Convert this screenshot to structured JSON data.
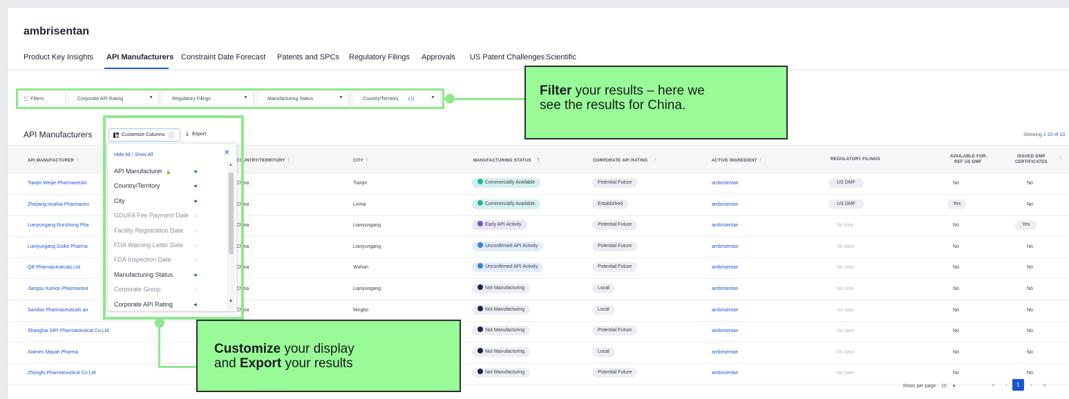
{
  "page": {
    "title": "ambrisentan",
    "tabs": [
      {
        "label": "Product Key Insights",
        "active": false
      },
      {
        "label": "API Manufacturers",
        "active": true
      },
      {
        "label": "Constraint Date Forecast",
        "active": false
      },
      {
        "label": "Patents and SPCs",
        "active": false
      },
      {
        "label": "Regulatory Filings",
        "active": false
      },
      {
        "label": "Approvals",
        "active": false
      },
      {
        "label": "US Patent Challenges",
        "active": false
      },
      {
        "label": "Scientific",
        "active": false
      }
    ]
  },
  "filters": {
    "label": "Filters",
    "items": [
      {
        "label": "Corporate API Rating",
        "count": ""
      },
      {
        "label": "Regulatory Filings",
        "count": ""
      },
      {
        "label": "Manufacturing Status",
        "count": ""
      },
      {
        "label": "Country/Territory",
        "count": "(1)"
      }
    ]
  },
  "callouts": {
    "filter": {
      "bold": "Filter",
      "line1_rest": " your results – here we",
      "line2": "see the results for China."
    },
    "customize": {
      "bold1": "Customize",
      "line1_rest": " your display",
      "line2_pre": "and ",
      "bold2": "Export",
      "line2_rest": " your results"
    }
  },
  "section": {
    "title": "API Manufacturers",
    "customize_label": "Customize Columns",
    "export_label": "Export",
    "showing_prefix": "Showing ",
    "showing_range": "1-10 of 10"
  },
  "table": {
    "headers": [
      "API MANUFACTURER",
      "COUNTRY/TERRITORY",
      "CITY",
      "MANUFACTURING STATUS",
      "CORPORATE API RATING",
      "ACTIVE INGREDIENT",
      "REGULATORY FILINGS",
      "AVAILABLE FOR",
      "REF US DMF",
      "ISSUED GMP",
      "CERTIFICATES"
    ],
    "rows": [
      {
        "manufacturer": "Tianjin Weijie Pharmaceutic",
        "country": "China",
        "city": "Tianjin",
        "status": "Commercially Available",
        "status_color": "#1fb5a0",
        "rating": "Potential Future",
        "ingredient": "ambrisentan",
        "filings": "US DMF",
        "avail": "No",
        "gmp": "No"
      },
      {
        "manufacturer": "Zhejiang Huahai Pharmaceu",
        "country": "China",
        "city": "Linhai",
        "status": "Commercially Available",
        "status_color": "#1fb5a0",
        "rating": "Established",
        "ingredient": "ambrisentan",
        "filings": "US DMF",
        "avail": "Yes",
        "gmp": "No"
      },
      {
        "manufacturer": "Lianyungang Runzhong Pha",
        "country": "China",
        "city": "Lianyungang",
        "status": "Early API Activity",
        "status_color": "#7b4fd6",
        "rating": "Potential Future",
        "ingredient": "ambrisentan",
        "filings": "No data",
        "avail": "No",
        "gmp": "Yes"
      },
      {
        "manufacturer": "Lianyungang Guike Pharma",
        "country": "China",
        "city": "Lianyungang",
        "status": "Unconfirmed API Activity",
        "status_color": "#3b7de8",
        "rating": "Potential Future",
        "ingredient": "ambrisentan",
        "filings": "No data",
        "avail": "No",
        "gmp": "No"
      },
      {
        "manufacturer": "QR Pharmaceuticals Ltd",
        "country": "China",
        "city": "Wuhan",
        "status": "Unconfirmed API Activity",
        "status_color": "#3b7de8",
        "rating": "Potential Future",
        "ingredient": "ambrisentan",
        "filings": "No data",
        "avail": "No",
        "gmp": "No"
      },
      {
        "manufacturer": "Jiangsu Kanion Pharmaceut",
        "country": "China",
        "city": "Lianyungang",
        "status": "Not Manufacturing",
        "status_color": "#1d2445",
        "rating": "Local",
        "ingredient": "ambrisentan",
        "filings": "No data",
        "avail": "No",
        "gmp": "No"
      },
      {
        "manufacturer": "Sandoo Pharmaceuticals an",
        "country": "China",
        "city": "Ningbo",
        "status": "Not Manufacturing",
        "status_color": "#1d2445",
        "rating": "Local",
        "ingredient": "ambrisentan",
        "filings": "No data",
        "avail": "No",
        "gmp": "No"
      },
      {
        "manufacturer": "Shanghai SIPI Pharmaceutical Co Ltd",
        "country": "",
        "city": "",
        "status": "Not Manufacturing",
        "status_color": "#1d2445",
        "rating": "Potential Future",
        "ingredient": "ambrisentan",
        "filings": "No data",
        "avail": "No",
        "gmp": "No"
      },
      {
        "manufacturer": "Xiamen Mayah Pharma",
        "country": "",
        "city": "",
        "status": "Not Manufacturing",
        "status_color": "#1d2445",
        "rating": "Local",
        "ingredient": "ambrisentan",
        "filings": "No data",
        "avail": "No",
        "gmp": "No"
      },
      {
        "manufacturer": "Zhongfu Pharmaceutical Co Ltd",
        "country": "",
        "city": "",
        "status": "Not Manufacturing",
        "status_color": "#1d2445",
        "rating": "Potential Future",
        "ingredient": "ambrisentan",
        "filings": "No data",
        "avail": "No",
        "gmp": "No"
      }
    ]
  },
  "dropdown": {
    "hide_show": "Hide All / Show All",
    "items": [
      {
        "label": "API Manufacturer",
        "visible": true,
        "locked": true
      },
      {
        "label": "Country/Territory",
        "visible": true,
        "locked": false
      },
      {
        "label": "City",
        "visible": true,
        "locked": false
      },
      {
        "label": "GDUFA Fee Payment Date",
        "visible": false,
        "locked": false
      },
      {
        "label": "Facility Registration Date",
        "visible": false,
        "locked": false
      },
      {
        "label": "FDA Warning Letter Date",
        "visible": false,
        "locked": false
      },
      {
        "label": "FDA Inspection Date",
        "visible": false,
        "locked": false
      },
      {
        "label": "Manufacturing Status",
        "visible": true,
        "locked": false
      },
      {
        "label": "Corporate Group",
        "visible": false,
        "locked": false
      },
      {
        "label": "Corporate API Rating",
        "visible": true,
        "locked": false
      }
    ]
  },
  "pagination": {
    "rows_label": "Rows per page:",
    "rows_value": "10",
    "current_page": "1"
  },
  "colors": {
    "accent": "#1b55d6",
    "callout_fill": "#98fb98",
    "highlight": "#8fe88e"
  }
}
